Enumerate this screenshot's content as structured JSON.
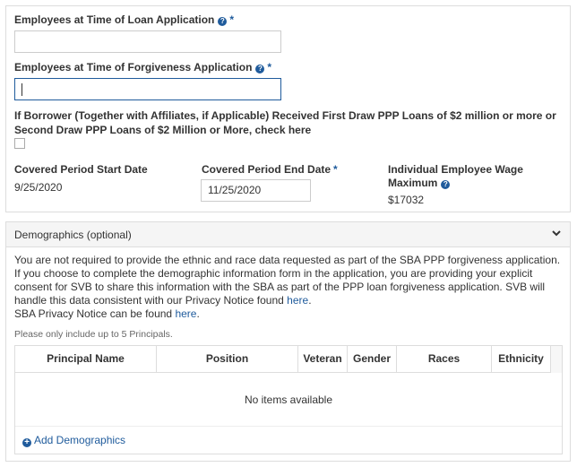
{
  "loan_section": {
    "employees_loan_label": "Employees at Time of Loan Application",
    "employees_loan_value": "",
    "employees_forgiveness_label": "Employees at Time of Forgiveness Application",
    "employees_forgiveness_value": "",
    "required_mark": "*",
    "help_glyph": "?",
    "borrower_label": "If Borrower (Together with Affiliates, if Applicable) Received First Draw PPP Loans of $2 million or more or Second Draw PPP Loans of $2 Million or More, check here",
    "borrower_checked": false,
    "period_start_label": "Covered Period Start Date",
    "period_start_value": "9/25/2020",
    "period_end_label": "Covered Period End Date",
    "period_end_value": "11/25/2020",
    "wage_max_label": "Individual Employee Wage Maximum",
    "wage_max_value": "$17032"
  },
  "demographics": {
    "title": "Demographics (optional)",
    "para_1": "You are not required to provide the ethnic and race data requested as part of the SBA PPP forgiveness application. If you choose to complete the demographic information form in the application, you are providing your explicit consent for SVB to share this information with the SBA as part of the PPP loan forgiveness application. SVB will handle this data consistent with our Privacy Notice found ",
    "link_1": "here",
    "para_1_end": ".",
    "para_2": "SBA Privacy Notice can be found ",
    "link_2": "here",
    "para_2_end": ".",
    "note": "Please only include up to 5 Principals.",
    "columns": [
      "Principal Name",
      "Position",
      "Veteran",
      "Gender",
      "Races",
      "Ethnicity"
    ],
    "empty_text": "No items available",
    "add_label": "Add Demographics",
    "add_glyph": "+"
  },
  "colors": {
    "accent": "#1f5b9c",
    "border": "#dddddd",
    "header_bg": "#f5f5f5"
  },
  "icons": {
    "help": "question-circle-icon",
    "collapse": "chevron-down-icon",
    "add": "plus-circle-icon"
  }
}
